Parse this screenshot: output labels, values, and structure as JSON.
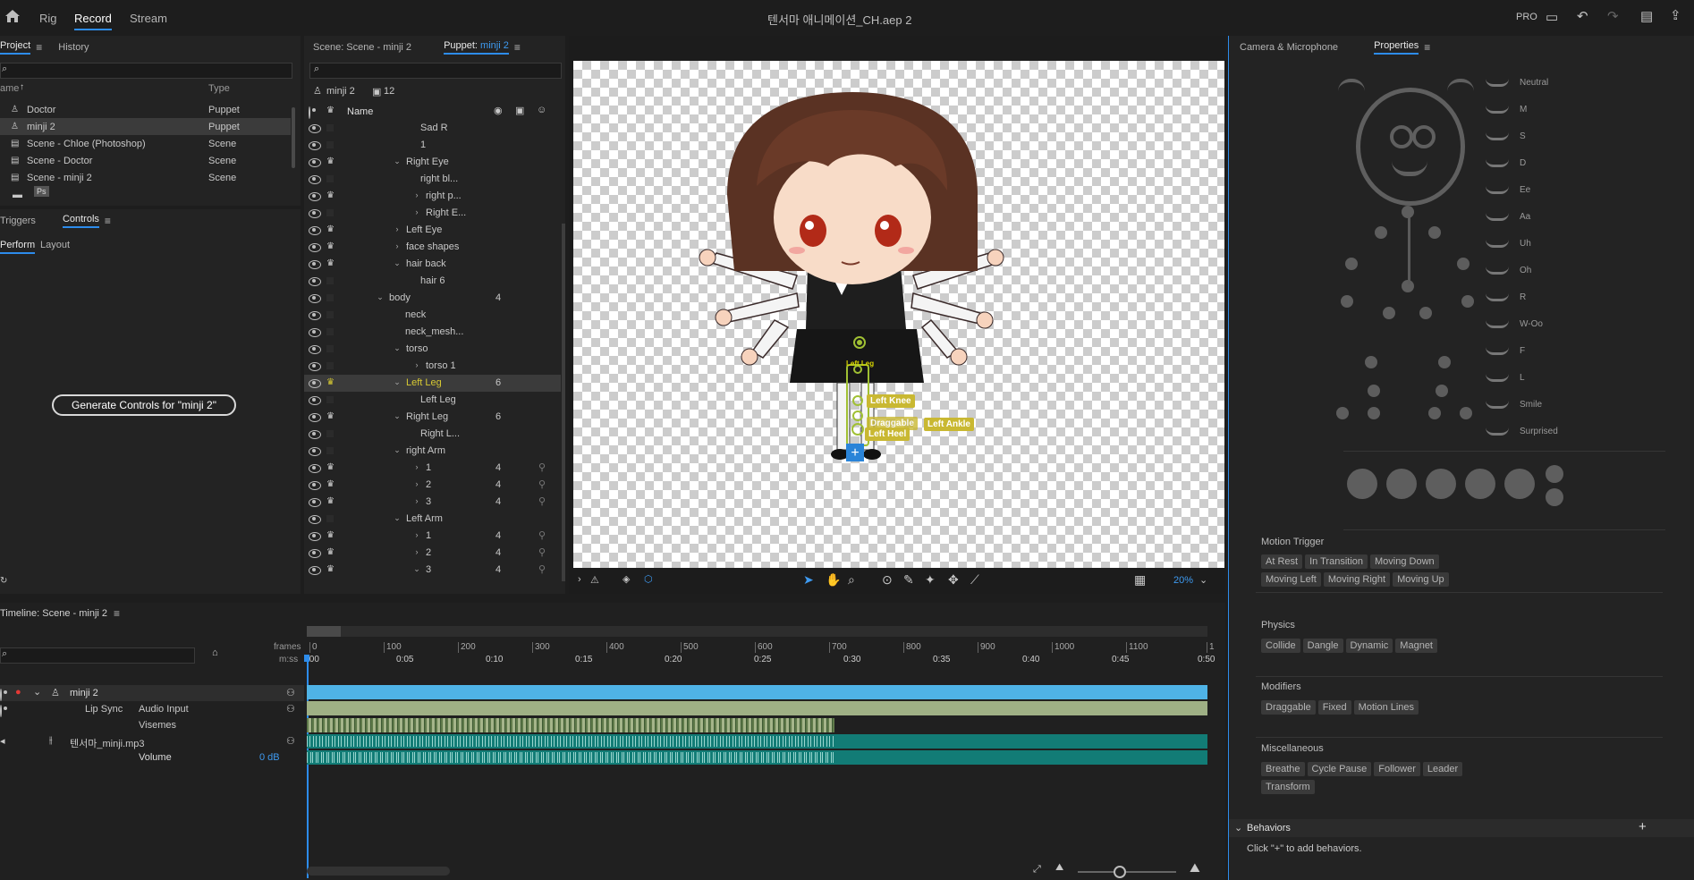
{
  "topbar": {
    "tabs": [
      "Rig",
      "Record",
      "Stream"
    ],
    "active_tab": "Record",
    "title": "텐서마 애니메이션_CH.aep 2",
    "pro_label": "PRO"
  },
  "project_panel": {
    "tabs": [
      "Project",
      "History"
    ],
    "col_name": "ame",
    "col_type": "Type",
    "items": [
      {
        "name": "Doctor",
        "type": "Puppet"
      },
      {
        "name": "minji 2",
        "type": "Puppet"
      },
      {
        "name": "Scene - Chloe (Photoshop)",
        "type": "Scene"
      },
      {
        "name": "Scene - Doctor",
        "type": "Scene"
      },
      {
        "name": "Scene - minji 2",
        "type": "Scene"
      }
    ],
    "ps_badge": "Ps"
  },
  "controls_panel": {
    "tabs": [
      "Triggers",
      "Controls"
    ],
    "subtabs": [
      "Perform",
      "Layout"
    ],
    "generate_button": "Generate Controls for \"minji 2\""
  },
  "puppet_panel": {
    "scene_tab": "Scene: Scene - minji 2",
    "puppet_tab_prefix": "Puppet:",
    "puppet_tab_name": "minji 2",
    "puppet_name": "minji 2",
    "count": "12",
    "col_name": "Name",
    "rows": [
      {
        "label": "Sad R",
        "chev": "",
        "num": "",
        "crown": false,
        "selected": false
      },
      {
        "label": "1",
        "chev": "",
        "num": "",
        "crown": false,
        "selected": false
      },
      {
        "label": "Right Eye",
        "chev": "v",
        "num": "",
        "crown": true,
        "selected": false
      },
      {
        "label": "right bl...",
        "chev": "",
        "num": "",
        "crown": false,
        "selected": false
      },
      {
        "label": "right p...",
        "chev": ">",
        "num": "",
        "crown": true,
        "selected": false
      },
      {
        "label": "Right E...",
        "chev": ">",
        "num": "",
        "crown": false,
        "selected": false
      },
      {
        "label": "Left Eye",
        "chev": ">",
        "num": "",
        "crown": true,
        "selected": false
      },
      {
        "label": "face shapes",
        "chev": ">",
        "num": "",
        "crown": true,
        "selected": false
      },
      {
        "label": "hair back",
        "chev": "v",
        "num": "",
        "crown": true,
        "selected": false
      },
      {
        "label": "hair 6",
        "chev": "",
        "num": "",
        "crown": false,
        "selected": false
      },
      {
        "label": "body",
        "chev": "v",
        "num": "4",
        "crown": false,
        "selected": false
      },
      {
        "label": "neck",
        "chev": "",
        "num": "",
        "crown": false,
        "selected": false
      },
      {
        "label": "neck_mesh...",
        "chev": "",
        "num": "",
        "crown": false,
        "selected": false
      },
      {
        "label": "torso",
        "chev": "v",
        "num": "",
        "crown": false,
        "selected": false
      },
      {
        "label": "torso 1",
        "chev": ">",
        "num": "",
        "crown": false,
        "selected": false
      },
      {
        "label": "Left Leg",
        "chev": "v",
        "num": "6",
        "crown": true,
        "selected": true
      },
      {
        "label": "Left Leg",
        "chev": "",
        "num": "",
        "crown": false,
        "selected": false
      },
      {
        "label": "Right Leg",
        "chev": "v",
        "num": "6",
        "crown": true,
        "selected": false
      },
      {
        "label": "Right L...",
        "chev": "",
        "num": "",
        "crown": false,
        "selected": false
      },
      {
        "label": "right Arm",
        "chev": "v",
        "num": "",
        "crown": false,
        "selected": false
      },
      {
        "label": "1",
        "chev": ">",
        "num": "4",
        "crown": true,
        "selected": false
      },
      {
        "label": "2",
        "chev": ">",
        "num": "4",
        "crown": true,
        "selected": false
      },
      {
        "label": "3",
        "chev": ">",
        "num": "4",
        "crown": true,
        "selected": false
      },
      {
        "label": "Left Arm",
        "chev": "v",
        "num": "",
        "crown": false,
        "selected": false
      },
      {
        "label": "1",
        "chev": ">",
        "num": "4",
        "crown": true,
        "selected": false
      },
      {
        "label": "2",
        "chev": ">",
        "num": "4",
        "crown": true,
        "selected": false
      },
      {
        "label": "3",
        "chev": "v",
        "num": "4",
        "crown": true,
        "selected": false
      }
    ]
  },
  "canvas": {
    "handles": [
      "Left Leg",
      "Left Knee",
      "Draggable",
      "Left Ankle",
      "Left Heel"
    ],
    "zoom": "20%"
  },
  "timeline": {
    "title": "Timeline: Scene - minji 2",
    "frames_label": "frames",
    "mss_label": "m:ss",
    "frame_ticks": [
      "0",
      "100",
      "200",
      "300",
      "400",
      "500",
      "600",
      "700",
      "800",
      "900",
      "1000",
      "1100",
      "1"
    ],
    "time_ticks": [
      ":00",
      "0:05",
      "0:10",
      "0:15",
      "0:20",
      "0:25",
      "0:30",
      "0:35",
      "0:40",
      "0:45",
      "0:50"
    ],
    "puppet_track": "minji 2",
    "lipsync_label": "Lip Sync",
    "audio_input": "Audio Input",
    "visemes": "Visemes",
    "audio_track": "텐서마_minji.mp3",
    "volume_label": "Volume",
    "volume_value": "0 dB"
  },
  "right_panel": {
    "tabs": [
      "Camera & Microphone",
      "Properties"
    ],
    "visemes": [
      "Neutral",
      "M",
      "S",
      "D",
      "Ee",
      "Aa",
      "Uh",
      "Oh",
      "R",
      "W-Oo",
      "F",
      "L",
      "Smile",
      "Surprised"
    ],
    "motion_trigger": {
      "title": "Motion Trigger",
      "tags": [
        "At Rest",
        "In Transition",
        "Moving Down",
        "Moving Left",
        "Moving Right",
        "Moving Up"
      ]
    },
    "physics": {
      "title": "Physics",
      "tags": [
        "Collide",
        "Dangle",
        "Dynamic",
        "Magnet"
      ]
    },
    "modifiers": {
      "title": "Modifiers",
      "tags": [
        "Draggable",
        "Fixed",
        "Motion Lines"
      ]
    },
    "misc": {
      "title": "Miscellaneous",
      "tags": [
        "Breathe",
        "Cycle Pause",
        "Follower",
        "Leader",
        "Transform"
      ]
    },
    "behaviors_title": "Behaviors",
    "behaviors_hint": "Click \"+\" to add behaviors."
  }
}
